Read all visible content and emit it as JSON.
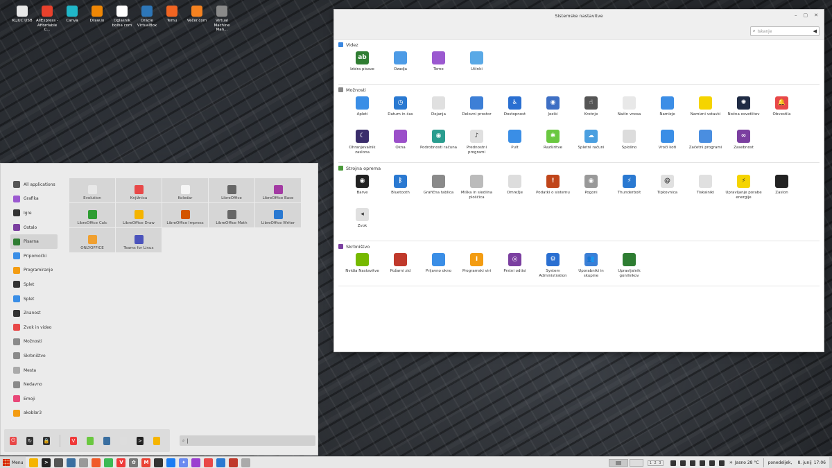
{
  "desktop": {
    "icons": [
      {
        "label": "KLJUC USB",
        "icon": "usb-icon",
        "color": "#e8e8e8"
      },
      {
        "label": "AliExpress - Affordable C...",
        "icon": "aliexpress-icon",
        "color": "#e8412c"
      },
      {
        "label": "Canva",
        "icon": "canva-icon",
        "color": "#20b7c9"
      },
      {
        "label": "Draw.io",
        "icon": "drawio-icon",
        "color": "#f08705"
      },
      {
        "label": "Oglasnik bolha com",
        "icon": "bolha-icon",
        "color": "#ffffff"
      },
      {
        "label": "Oracle VirtualBox",
        "icon": "virtualbox-icon",
        "color": "#2d76b8"
      },
      {
        "label": "Temu",
        "icon": "temu-icon",
        "color": "#f26522"
      },
      {
        "label": "Večer.com",
        "icon": "vecer-icon",
        "color": "#f58220"
      },
      {
        "label": "Virtual Machine Man...",
        "icon": "vmm-icon",
        "color": "#8a8a8a"
      }
    ]
  },
  "settings_window": {
    "title": "Sistemske nastavitve",
    "controls": [
      "–",
      "▢",
      "✕"
    ],
    "search_placeholder": "Iskanje",
    "sections": [
      {
        "title": "Videz",
        "color": "#3a87e0",
        "items": [
          {
            "label": "Izbira pisave",
            "icon": "font-icon",
            "color": "#2f7d32",
            "glyph": "ab"
          },
          {
            "label": "Ozadja",
            "icon": "wallpaper-icon",
            "color": "#4d9be6",
            "glyph": ""
          },
          {
            "label": "Teme",
            "icon": "themes-icon",
            "color": "#9b59d0",
            "glyph": ""
          },
          {
            "label": "Učinki",
            "icon": "effects-icon",
            "color": "#5aa9e6",
            "glyph": ""
          }
        ]
      },
      {
        "title": "Možnosti",
        "color": "#888888",
        "items": [
          {
            "label": "Apleti",
            "icon": "applets-icon",
            "color": "#3a8ee6",
            "glyph": ""
          },
          {
            "label": "Datum in čas",
            "icon": "clock-icon",
            "color": "#2a79d1",
            "glyph": "◷"
          },
          {
            "label": "Dejanja",
            "icon": "actions-icon",
            "color": "#e0e0e0",
            "glyph": ""
          },
          {
            "label": "Delovni prostor",
            "icon": "workspace-icon",
            "color": "#3d7fd6",
            "glyph": ""
          },
          {
            "label": "Dostopnost",
            "icon": "accessibility-icon",
            "color": "#2a6fd1",
            "glyph": "♿"
          },
          {
            "label": "Jeziki",
            "icon": "languages-icon",
            "color": "#3e6fc4",
            "glyph": "◉"
          },
          {
            "label": "Kretnje",
            "icon": "gestures-icon",
            "color": "#555555",
            "glyph": "☝"
          },
          {
            "label": "Način vnosa",
            "icon": "input-method-icon",
            "color": "#e8e8e8",
            "glyph": ""
          },
          {
            "label": "Namizje",
            "icon": "desktop-icon",
            "color": "#3c8ee6",
            "glyph": ""
          },
          {
            "label": "Namizni vstavki",
            "icon": "desklets-icon",
            "color": "#f5d400",
            "glyph": ""
          },
          {
            "label": "Nočna osvetlitev",
            "icon": "night-light-icon",
            "color": "#1f2b44",
            "glyph": "✺"
          },
          {
            "label": "Obvestila",
            "icon": "notifications-icon",
            "color": "#e84848",
            "glyph": "🔔"
          },
          {
            "label": "Ohranjevalnik zaslona",
            "icon": "screensaver-icon",
            "color": "#3a2d6b",
            "glyph": "☾"
          },
          {
            "label": "Okna",
            "icon": "windows-icon",
            "color": "#9b4fc9",
            "glyph": ""
          },
          {
            "label": "Podrobnosti računa",
            "icon": "account-icon",
            "color": "#2a9d8f",
            "glyph": "◉"
          },
          {
            "label": "Prednostni programi",
            "icon": "preferred-apps-icon",
            "color": "#e0e0e0",
            "glyph": "♪"
          },
          {
            "label": "Pult",
            "icon": "panel-icon",
            "color": "#3a8ee6",
            "glyph": ""
          },
          {
            "label": "Razširitve",
            "icon": "extensions-icon",
            "color": "#6ac840",
            "glyph": "✱"
          },
          {
            "label": "Spletni računi",
            "icon": "online-accounts-icon",
            "color": "#4a9fe0",
            "glyph": "☁"
          },
          {
            "label": "Splošno",
            "icon": "general-icon",
            "color": "#dcdcdc",
            "glyph": ""
          },
          {
            "label": "Vroči koti",
            "icon": "hot-corners-icon",
            "color": "#3a8ee6",
            "glyph": ""
          },
          {
            "label": "Začetni programi",
            "icon": "startup-apps-icon",
            "color": "#4a8ee0",
            "glyph": ""
          },
          {
            "label": "Zasebnost",
            "icon": "privacy-icon",
            "color": "#7b3fa0",
            "glyph": "∞"
          }
        ]
      },
      {
        "title": "Strojna oprema",
        "color": "#4a9a3a",
        "items": [
          {
            "label": "Barve",
            "icon": "color-icon",
            "color": "#222222",
            "glyph": "◉"
          },
          {
            "label": "Bluetooth",
            "icon": "bluetooth-icon",
            "color": "#2a79d1",
            "glyph": "ᛒ"
          },
          {
            "label": "Grafična tablica",
            "icon": "tablet-icon",
            "color": "#8a8a8a",
            "glyph": ""
          },
          {
            "label": "Miška in sledilna ploščica",
            "icon": "mouse-icon",
            "color": "#bbbbbb",
            "glyph": ""
          },
          {
            "label": "Omrežje",
            "icon": "network-icon",
            "color": "#dddddd",
            "glyph": ""
          },
          {
            "label": "Podatki o sistemu",
            "icon": "system-info-icon",
            "color": "#c0451a",
            "glyph": "!"
          },
          {
            "label": "Pogoni",
            "icon": "drives-icon",
            "color": "#999999",
            "glyph": "◉"
          },
          {
            "label": "Thunderbolt",
            "icon": "thunderbolt-icon",
            "color": "#2a79d1",
            "glyph": "⚡"
          },
          {
            "label": "Tipkovnica",
            "icon": "keyboard-icon",
            "color": "#e0e0e0",
            "glyph": "@"
          },
          {
            "label": "Tiskalniki",
            "icon": "printer-icon",
            "color": "#e0e0e0",
            "glyph": ""
          },
          {
            "label": "Upravljanje porabe energije",
            "icon": "power-icon",
            "color": "#f5d400",
            "glyph": "⚡"
          },
          {
            "label": "Zaslon",
            "icon": "display-icon",
            "color": "#222222",
            "glyph": ""
          },
          {
            "label": "Zvok",
            "icon": "sound-icon",
            "color": "#e0e0e0",
            "glyph": "◂"
          }
        ]
      },
      {
        "title": "Skrbništvo",
        "color": "#7b3fa0",
        "items": [
          {
            "label": "Nvidia Nastavitve",
            "icon": "nvidia-icon",
            "color": "#76b900",
            "glyph": ""
          },
          {
            "label": "Požarni zid",
            "icon": "firewall-icon",
            "color": "#c0392b",
            "glyph": ""
          },
          {
            "label": "Prijavno okno",
            "icon": "login-window-icon",
            "color": "#3a8ee6",
            "glyph": ""
          },
          {
            "label": "Programski viri",
            "icon": "software-sources-icon",
            "color": "#f39c12",
            "glyph": "i"
          },
          {
            "label": "Prstni odtisi",
            "icon": "fingerprint-icon",
            "color": "#7b3fa0",
            "glyph": "◎"
          },
          {
            "label": "System Administration",
            "icon": "sysadmin-icon",
            "color": "#2a6fd1",
            "glyph": "⚙"
          },
          {
            "label": "Uporabniki in skupine",
            "icon": "users-icon",
            "color": "#3a7fd6",
            "glyph": "👥"
          },
          {
            "label": "Upravljalnik gonilnikov",
            "icon": "driver-manager-icon",
            "color": "#2e7d32",
            "glyph": ""
          }
        ]
      }
    ]
  },
  "menu": {
    "categories": [
      {
        "label": "All applications",
        "icon": "all-apps-icon",
        "color": "#555555"
      },
      {
        "label": "Grafika",
        "icon": "graphics-icon",
        "color": "#9b59d0"
      },
      {
        "label": "Igre",
        "icon": "games-icon",
        "color": "#333333"
      },
      {
        "label": "Ostalo",
        "icon": "other-icon",
        "color": "#7b3fa0"
      },
      {
        "label": "Pisarna",
        "icon": "office-icon",
        "color": "#2e7d32"
      },
      {
        "label": "Pripomočki",
        "icon": "accessories-icon",
        "color": "#3a8ee6"
      },
      {
        "label": "Programiranje",
        "icon": "programming-icon",
        "color": "#f39c12"
      },
      {
        "label": "Splet",
        "icon": "internet-icon",
        "color": "#333333"
      },
      {
        "label": "Splet",
        "icon": "web-icon",
        "color": "#3a8ee6"
      },
      {
        "label": "Znanost",
        "icon": "science-icon",
        "color": "#333333"
      },
      {
        "label": "Zvok in video",
        "icon": "sound-video-icon",
        "color": "#e84848"
      },
      {
        "label": "Možnosti",
        "icon": "preferences-icon",
        "color": "#8a8a8a"
      },
      {
        "label": "Skrbništvo",
        "icon": "administration-icon",
        "color": "#8a8a8a"
      },
      {
        "label": "Mesta",
        "icon": "places-icon",
        "color": "#aaaaaa"
      },
      {
        "label": "Nedavno",
        "icon": "recent-icon",
        "color": "#8a8a8a"
      },
      {
        "label": "Emoji",
        "icon": "emoji-icon",
        "color": "#e84878"
      },
      {
        "label": "akoblar3",
        "icon": "home-folder-icon",
        "color": "#f39c12"
      }
    ],
    "active_category": "Pisarna",
    "apps": [
      {
        "label": "Evolution",
        "icon": "evolution-icon",
        "color": "#e8e8e8"
      },
      {
        "label": "Knjižnica",
        "icon": "library-icon",
        "color": "#e84848"
      },
      {
        "label": "Koledar",
        "icon": "calendar-icon",
        "color": "#f5f5f5"
      },
      {
        "label": "LibreOffice",
        "icon": "libreoffice-icon",
        "color": "#666666"
      },
      {
        "label": "LibreOffice Base",
        "icon": "lo-base-icon",
        "color": "#a33aa3"
      },
      {
        "label": "LibreOffice Calc",
        "icon": "lo-calc-icon",
        "color": "#2e9d32"
      },
      {
        "label": "LibreOffice Draw",
        "icon": "lo-draw-icon",
        "color": "#f5b400"
      },
      {
        "label": "LibreOffice Impress",
        "icon": "lo-impress-icon",
        "color": "#d35400"
      },
      {
        "label": "LibreOffice Math",
        "icon": "lo-math-icon",
        "color": "#666666"
      },
      {
        "label": "LibreOffice Writer",
        "icon": "lo-writer-icon",
        "color": "#2a79d1"
      },
      {
        "label": "ONLYOFFICE",
        "icon": "onlyoffice-icon",
        "color": "#f0a030"
      },
      {
        "label": "Teams for Linux",
        "icon": "teams-icon",
        "color": "#4b53bc"
      }
    ],
    "favorites": [
      {
        "icon": "shutdown-icon",
        "color": "#e84848",
        "glyph": "⏻"
      },
      {
        "icon": "logout-icon",
        "color": "#333333",
        "glyph": "↻"
      },
      {
        "icon": "lock-icon",
        "color": "#333333",
        "glyph": "🔒"
      },
      {
        "icon": "sep"
      },
      {
        "icon": "vivaldi-icon",
        "color": "#ef3939",
        "glyph": "V"
      },
      {
        "icon": "grass-icon",
        "color": "#6ac840",
        "glyph": ""
      },
      {
        "icon": "software-manager-icon",
        "color": "#3a6fa0",
        "glyph": ""
      },
      {
        "icon": "settings-icon",
        "color": "#dddddd",
        "glyph": ""
      },
      {
        "icon": "terminal-icon",
        "color": "#222222",
        "glyph": ">"
      },
      {
        "icon": "files-icon",
        "color": "#f5b400",
        "glyph": ""
      }
    ],
    "search_value": "|"
  },
  "taskbar": {
    "menu_label": "Menu",
    "apps": [
      {
        "icon": "files-icon",
        "color": "#f5b400",
        "glyph": ""
      },
      {
        "icon": "terminal-icon",
        "color": "#222222",
        "glyph": ">"
      },
      {
        "icon": "calculator-icon",
        "color": "#555555",
        "glyph": ""
      },
      {
        "icon": "software-manager-icon",
        "color": "#3a6fa0",
        "glyph": ""
      },
      {
        "icon": "settings-icon",
        "color": "#999999",
        "glyph": ""
      },
      {
        "icon": "brave-icon",
        "color": "#f05a28",
        "glyph": ""
      },
      {
        "icon": "chrome-icon",
        "color": "#3cba54",
        "glyph": ""
      },
      {
        "icon": "vivaldi-icon",
        "color": "#ef3939",
        "glyph": "V"
      },
      {
        "icon": "openai-icon",
        "color": "#777777",
        "glyph": "✿"
      },
      {
        "icon": "gmail-icon",
        "color": "#ea4335",
        "glyph": "M"
      },
      {
        "icon": "fingerprint-app-icon",
        "color": "#333333",
        "glyph": ""
      },
      {
        "icon": "messenger-icon",
        "color": "#1a7cf3",
        "glyph": ""
      },
      {
        "icon": "gemini-icon",
        "color": "#6a8af0",
        "glyph": "✦"
      },
      {
        "icon": "firefox-icon",
        "color": "#9b3fd0",
        "glyph": ""
      },
      {
        "icon": "figma-icon",
        "color": "#e84848",
        "glyph": ""
      },
      {
        "icon": "vscode-icon",
        "color": "#2a79d1",
        "glyph": ""
      },
      {
        "icon": "store-icon",
        "color": "#c0392b",
        "glyph": ""
      },
      {
        "icon": "system-settings-icon",
        "color": "#aaaaaa",
        "glyph": ""
      }
    ],
    "workspace_numbers": "1 2 3",
    "weather": "Jasno 28 °C",
    "date": "ponedeljek,",
    "day": "8. junij",
    "time": "17:06"
  }
}
